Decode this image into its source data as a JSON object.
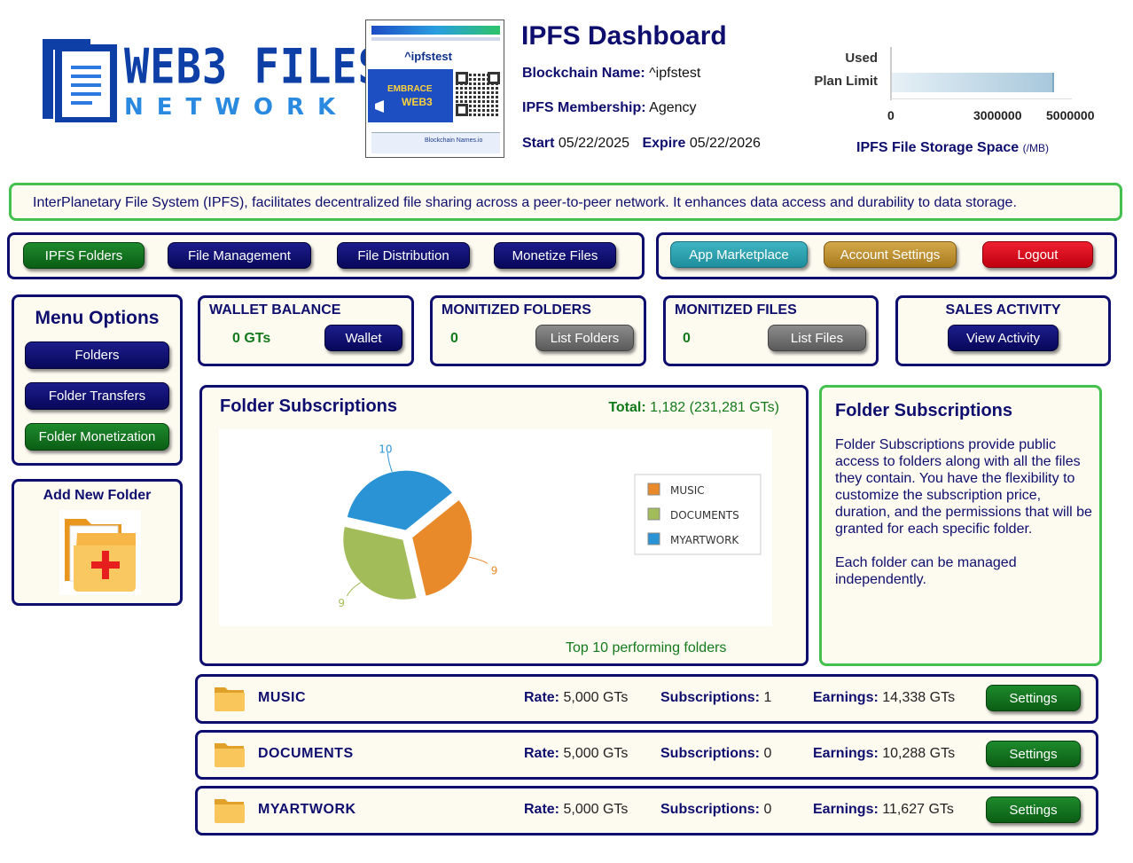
{
  "brand": {
    "logo_top": "WEB3 FILES",
    "logo_bottom": "NETWORK",
    "card_handle": "^ipfstest",
    "card_embrace": "EMBRACE",
    "card_web3": "WEB3",
    "card_footer": "Blockchain Names.io"
  },
  "header": {
    "title": "IPFS Dashboard",
    "blockchain_name_label": "Blockchain Name:",
    "blockchain_name_value": "^ipfstest",
    "membership_label": "IPFS Membership:",
    "membership_value": "Agency",
    "start_label": "Start",
    "start_value": "05/22/2025",
    "expire_label": "Expire",
    "expire_value": "05/22/2026"
  },
  "storage_chart": {
    "used_label": "Used",
    "limit_label": "Plan Limit",
    "ticks": [
      "0",
      "3000000",
      "5000000"
    ],
    "title": "IPFS File Storage Space",
    "unit": "(/MB)",
    "used_value": 0,
    "limit_value": 4500000,
    "max": 5000000,
    "bar_color": "#a8c8dc"
  },
  "banner": {
    "text": "InterPlanetary File System (IPFS), facilitates decentralized file sharing across a peer-to-peer network. It enhances data access and durability to data storage."
  },
  "nav": {
    "ipfs_folders": "IPFS Folders",
    "file_management": "File Management",
    "file_distribution": "File Distribution",
    "monetize_files": "Monetize Files",
    "app_marketplace": "App Marketplace",
    "account_settings": "Account Settings",
    "logout": "Logout"
  },
  "menu": {
    "title": "Menu Options",
    "folders": "Folders",
    "folder_transfers": "Folder Transfers",
    "folder_monetization": "Folder Monetization",
    "add_new_folder": "Add New Folder"
  },
  "stats": {
    "wallet_title": "WALLET BALANCE",
    "wallet_value": "0 GTs",
    "wallet_button": "Wallet",
    "folders_title": "MONITIZED FOLDERS",
    "folders_value": "0",
    "folders_button": "List Folders",
    "files_title": "MONITIZED FILES",
    "files_value": "0",
    "files_button": "List Files",
    "sales_title": "SALES ACTIVITY",
    "sales_button": "View Activity"
  },
  "subscriptions": {
    "title": "Folder Subscriptions",
    "total_label": "Total:",
    "total_value": "1,182 (231,281 GTs)",
    "footer": "Top 10 performing folders"
  },
  "chart_data": {
    "type": "pie",
    "categories": [
      "MUSIC",
      "DOCUMENTS",
      "MYARTWORK"
    ],
    "values": [
      9,
      9,
      10
    ],
    "labels": [
      "9",
      "9",
      "10"
    ],
    "colors": [
      "#e8892a",
      "#a3bc5a",
      "#2a93d5"
    ],
    "legend_position": "right"
  },
  "info": {
    "title": "Folder Subscriptions",
    "para1": "Folder Subscriptions provide public access to folders along with all the files they contain. You have the flexibility to customize the subscription price, duration, and the permissions that will be granted for each specific folder.",
    "para2": "Each folder can be managed independently."
  },
  "folders": [
    {
      "name": "MUSIC",
      "rate_label": "Rate:",
      "rate": "5,000 GTs",
      "subs_label": "Subscriptions:",
      "subs": "1",
      "earn_label": "Earnings:",
      "earn": "14,338 GTs",
      "button": "Settings"
    },
    {
      "name": "DOCUMENTS",
      "rate_label": "Rate:",
      "rate": "5,000 GTs",
      "subs_label": "Subscriptions:",
      "subs": "0",
      "earn_label": "Earnings:",
      "earn": "10,288 GTs",
      "button": "Settings"
    },
    {
      "name": "MYARTWORK",
      "rate_label": "Rate:",
      "rate": "5,000 GTs",
      "subs_label": "Subscriptions:",
      "subs": "0",
      "earn_label": "Earnings:",
      "earn": "11,627 GTs",
      "button": "Settings"
    }
  ]
}
